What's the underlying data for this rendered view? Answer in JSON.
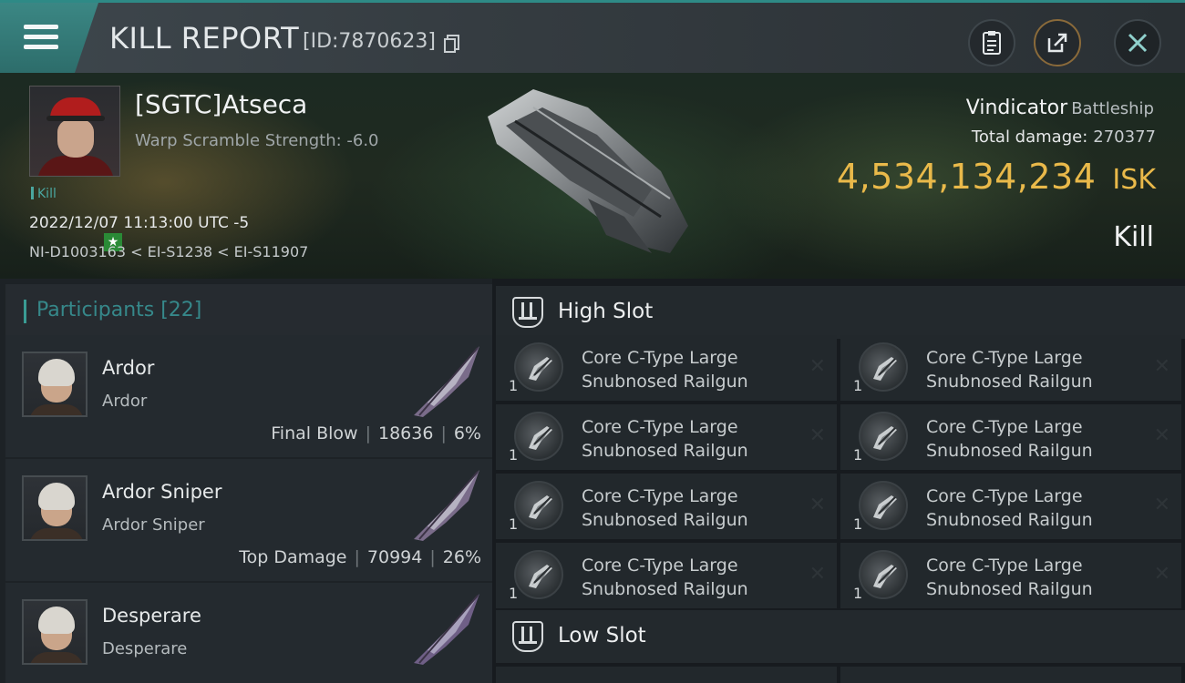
{
  "header": {
    "title": "KILL REPORT",
    "id_text": "[ID:7870623]"
  },
  "victim": {
    "name": "[SGTC]Atseca",
    "warp_scramble": "Warp Scramble Strength: -6.0",
    "kill_tag": "Kill",
    "datetime": "2022/12/07 11:13:00 UTC -5",
    "location": "NI-D1003163 < EI-S1238 < EI-S11907"
  },
  "ship": {
    "name": "Vindicator",
    "class": "Battleship",
    "total_damage_label": "Total damage:",
    "total_damage": "270377",
    "isk_value": "4,534,134,234",
    "isk_unit": "ISK",
    "result": "Kill"
  },
  "participants": {
    "label": "Participants [22]",
    "rows": [
      {
        "name": "Ardor",
        "corp": "Ardor",
        "role": "Final Blow",
        "damage": "18636",
        "percent": "6%"
      },
      {
        "name": "Ardor Sniper",
        "corp": "Ardor Sniper",
        "role": "Top Damage",
        "damage": "70994",
        "percent": "26%"
      },
      {
        "name": "Desperare",
        "corp": "Desperare"
      }
    ]
  },
  "slots": {
    "high": {
      "title": "High Slot",
      "modules": [
        {
          "line1": "Core C-Type Large",
          "line2": "Snubnosed Railgun",
          "qty": "1"
        },
        {
          "line1": "Core C-Type Large",
          "line2": "Snubnosed Railgun",
          "qty": "1"
        },
        {
          "line1": "Core C-Type Large",
          "line2": "Snubnosed Railgun",
          "qty": "1"
        },
        {
          "line1": "Core C-Type Large",
          "line2": "Snubnosed Railgun",
          "qty": "1"
        },
        {
          "line1": "Core C-Type Large",
          "line2": "Snubnosed Railgun",
          "qty": "1"
        },
        {
          "line1": "Core C-Type Large",
          "line2": "Snubnosed Railgun",
          "qty": "1"
        },
        {
          "line1": "Core C-Type Large",
          "line2": "Snubnosed Railgun",
          "qty": "1"
        },
        {
          "line1": "Core C-Type Large",
          "line2": "Snubnosed Railgun",
          "qty": "1"
        }
      ]
    },
    "low": {
      "title": "Low Slot"
    }
  },
  "icons": {
    "menu": "hamburger-menu-icon",
    "copy": "copy-icon",
    "clipboard": "clipboard-icon",
    "share": "share-icon",
    "close": "close-icon",
    "slot": "slot-icon",
    "remove": "close-icon"
  },
  "colors": {
    "accent_teal": "#2e8a86",
    "isk_gold": "#e9b94a",
    "participants_label": "#36888a"
  }
}
